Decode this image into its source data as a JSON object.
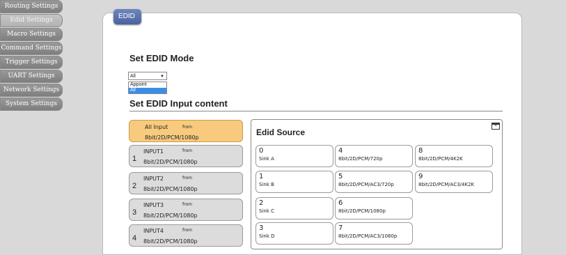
{
  "sidebar": {
    "items": [
      {
        "label": "Routing Settings"
      },
      {
        "label": "Edid Settings"
      },
      {
        "label": "Macro Settings"
      },
      {
        "label": "Command Settings"
      },
      {
        "label": "Trigger Settings"
      },
      {
        "label": "UART Settings"
      },
      {
        "label": "Network Settings"
      },
      {
        "label": "System Settings"
      }
    ],
    "active_index": 1
  },
  "panel": {
    "tab_label": "EDID",
    "mode_heading": "Set EDID Mode",
    "mode_select": {
      "selected": "All",
      "options": [
        "Appoint",
        "All"
      ]
    },
    "input_heading": "Set EDID Input content"
  },
  "inputs": [
    {
      "num": "",
      "name": "All Input",
      "from": "from",
      "format": "8bit/2D/PCM/1080p"
    },
    {
      "num": "1",
      "name": "INPUT1",
      "from": "from",
      "format": "8bit/2D/PCM/1080p"
    },
    {
      "num": "2",
      "name": "INPUT2",
      "from": "from",
      "format": "8bit/2D/PCM/1080p"
    },
    {
      "num": "3",
      "name": "INPUT3",
      "from": "from",
      "format": "8bit/2D/PCM/1080p"
    },
    {
      "num": "4",
      "name": "INPUT4",
      "from": "from",
      "format": "8bit/2D/PCM/1080p"
    }
  ],
  "edid_source": {
    "title": "Edid Source",
    "close_icon": "close-icon",
    "items": [
      {
        "num": "0",
        "label": "Sink A"
      },
      {
        "num": "1",
        "label": "Sink B"
      },
      {
        "num": "2",
        "label": "Sink C"
      },
      {
        "num": "3",
        "label": "Sink D"
      },
      {
        "num": "4",
        "label": "8bit/2D/PCM/720p"
      },
      {
        "num": "5",
        "label": "8bit/2D/PCM/AC3/720p"
      },
      {
        "num": "6",
        "label": "8bit/2D/PCM/1080p"
      },
      {
        "num": "7",
        "label": "8bit/2D/PCM/AC3/1080p"
      },
      {
        "num": "8",
        "label": "8bit/2D/PCM/4K2K"
      },
      {
        "num": "9",
        "label": "8bit/2D/PCM/AC3/4K2K"
      }
    ]
  },
  "colors": {
    "tab_accent": "#4a62a0",
    "all_input_highlight": "#f7ca7e",
    "dropdown_selected": "#3b8ee8"
  }
}
